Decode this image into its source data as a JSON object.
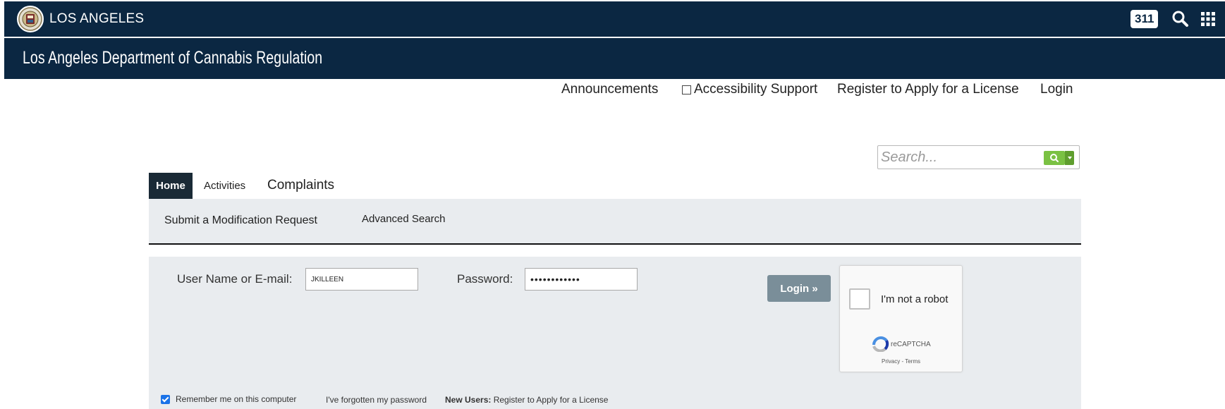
{
  "citybar": {
    "city_name": "LOS ANGELES",
    "badge_311": "311",
    "colors": {
      "background": "#0b2742",
      "text": "#ffffff"
    }
  },
  "department": {
    "title": "Los Angeles Department of Cannabis Regulation"
  },
  "utility_links": {
    "announcements": "Announcements",
    "accessibility": "Accessibility Support",
    "register": "Register to Apply for a License",
    "login": "Login"
  },
  "search": {
    "placeholder": "Search...",
    "button_color": "#7ac143",
    "icon": "search-icon"
  },
  "tabs": [
    {
      "label": "Home",
      "active": true
    },
    {
      "label": "Activities",
      "active": false
    },
    {
      "label": "Complaints",
      "active": false
    }
  ],
  "subnav": {
    "modification": "Submit a Modification Request",
    "advanced_search": "Advanced Search"
  },
  "login_form": {
    "username_label": "User Name or E-mail:",
    "username_value": "JKILLEEN",
    "password_label": "Password:",
    "password_value": "••••••••••••",
    "login_button": "Login »",
    "button_color": "#7a8e99"
  },
  "recaptcha": {
    "label": "I'm not a robot",
    "brand": "reCAPTCHA",
    "terms": "Privacy - Terms"
  },
  "footer": {
    "remember_me": "Remember me on this computer",
    "remember_checked": true,
    "forgot_password": "I've forgotten my password",
    "new_users_label": "New Users:",
    "new_users_link": "Register to Apply for a License"
  }
}
